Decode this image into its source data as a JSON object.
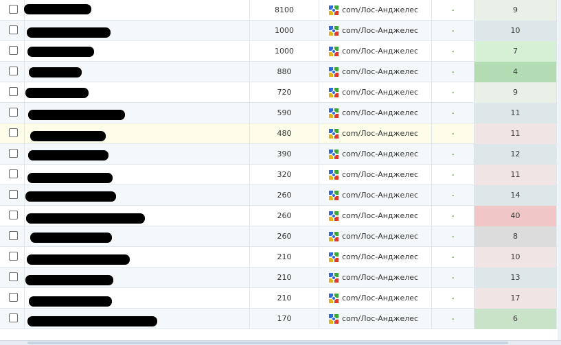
{
  "colors": {
    "pos_neutral": "#e8f0e8",
    "pos_blue": "#dde6e8",
    "pos_lightgreen": "#d5f0d5",
    "pos_green": "#b3dcb3",
    "pos_pink": "#f1e4e4",
    "pos_red": "#f1c6c6",
    "pos_gray": "#dcdcdc",
    "pos_mint": "#c8e3c8",
    "dash": "#4b8a2a"
  },
  "rows": [
    {
      "volume": "8100",
      "region": "com/Лос-Анджелес",
      "change": "-",
      "position": "9",
      "pos_color": "#e8f0e8",
      "bar": {
        "x": 35,
        "w": 98,
        "y": 6
      }
    },
    {
      "volume": "1000",
      "region": "com/Лос-Анджелес",
      "change": "-",
      "position": "10",
      "pos_color": "#dde6e8",
      "bar": {
        "x": 39,
        "w": 122,
        "y": 10
      }
    },
    {
      "volume": "1000",
      "region": "com/Лос-Анджелес",
      "change": "-",
      "position": "7",
      "pos_color": "#d5f0d5",
      "bar": {
        "x": 40,
        "w": 97,
        "y": 8
      }
    },
    {
      "volume": "880",
      "region": "com/Лос-Анджелес",
      "change": "-",
      "position": "4",
      "pos_color": "#b3dcb3",
      "bar": {
        "x": 42,
        "w": 77,
        "y": 8
      }
    },
    {
      "volume": "720",
      "region": "com/Лос-Анджелес",
      "change": "-",
      "position": "9",
      "pos_color": "#e8f0e8",
      "bar": {
        "x": 37,
        "w": 92,
        "y": 8
      }
    },
    {
      "volume": "590",
      "region": "com/Лос-Анджелес",
      "change": "-",
      "position": "11",
      "pos_color": "#dde6e8",
      "bar": {
        "x": 41,
        "w": 141,
        "y": 10
      }
    },
    {
      "volume": "480",
      "region": "com/Лос-Анджелес",
      "change": "-",
      "position": "11",
      "pos_color": "#f1e4e4",
      "bar": {
        "x": 44,
        "w": 110,
        "y": 11
      }
    },
    {
      "volume": "390",
      "region": "com/Лос-Анджелес",
      "change": "-",
      "position": "12",
      "pos_color": "#dde6e8",
      "bar": {
        "x": 41,
        "w": 117,
        "y": 9
      }
    },
    {
      "volume": "320",
      "region": "com/Лос-Анджелес",
      "change": "-",
      "position": "11",
      "pos_color": "#f1e4e4",
      "bar": {
        "x": 40,
        "w": 124,
        "y": 12
      }
    },
    {
      "volume": "260",
      "region": "com/Лос-Анджелес",
      "change": "-",
      "position": "14",
      "pos_color": "#dde6e8",
      "bar": {
        "x": 37,
        "w": 132,
        "y": 9
      }
    },
    {
      "volume": "260",
      "region": "com/Лос-Анджелес",
      "change": "-",
      "position": "40",
      "pos_color": "#f1c6c6",
      "bar": {
        "x": 38,
        "w": 173,
        "y": 11
      }
    },
    {
      "volume": "260",
      "region": "com/Лос-Анджелес",
      "change": "-",
      "position": "8",
      "pos_color": "#dcdcdc",
      "bar": {
        "x": 44,
        "w": 119,
        "y": 9
      }
    },
    {
      "volume": "210",
      "region": "com/Лос-Анджелес",
      "change": "-",
      "position": "10",
      "pos_color": "#f1e4e4",
      "bar": {
        "x": 39,
        "w": 150,
        "y": 11
      }
    },
    {
      "volume": "210",
      "region": "com/Лос-Анджелес",
      "change": "-",
      "position": "13",
      "pos_color": "#dde6e8",
      "bar": {
        "x": 37,
        "w": 128,
        "y": 11
      }
    },
    {
      "volume": "210",
      "region": "com/Лос-Анджелес",
      "change": "-",
      "position": "17",
      "pos_color": "#f1e4e4",
      "bar": {
        "x": 42,
        "w": 121,
        "y": 12
      }
    },
    {
      "volume": "170",
      "region": "com/Лос-Анджелес",
      "change": "-",
      "position": "6",
      "pos_color": "#c8e3c8",
      "bar": {
        "x": 40,
        "w": 189,
        "y": 11
      }
    }
  ]
}
